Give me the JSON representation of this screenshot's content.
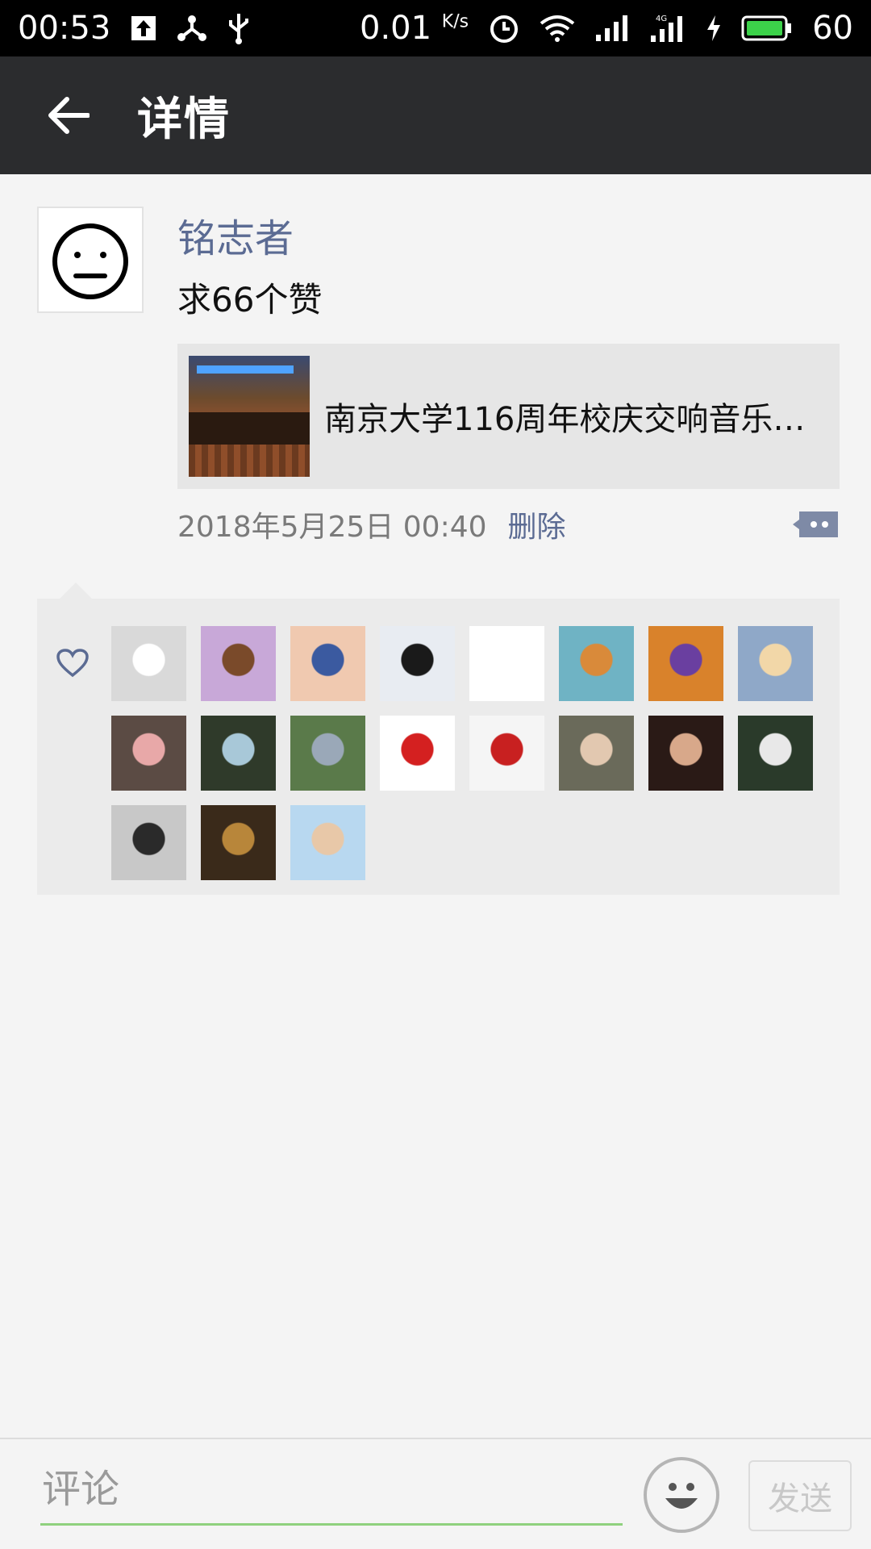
{
  "status_bar": {
    "time": "00:53",
    "net_speed": "0.01",
    "net_unit": "K/s",
    "battery": "60",
    "icons": [
      "upload-icon",
      "usb-tether-icon",
      "usb-icon",
      "alarm-icon",
      "wifi-icon",
      "signal-icon",
      "signal-4g-icon",
      "charging-icon",
      "battery-icon"
    ]
  },
  "app_bar": {
    "title": "详情",
    "back_icon": "back-arrow-icon"
  },
  "post": {
    "author": "铭志者",
    "text": "求66个赞",
    "link": {
      "title": "南京大学116周年校庆交响音乐…"
    },
    "timestamp": "2018年5月25日 00:40",
    "delete_label": "删除",
    "comment_icon": "comment-bubble-icon"
  },
  "likes": {
    "icon": "heart-icon",
    "likers": [
      {
        "color": "#d9d9d9",
        "accent": "#ffffff"
      },
      {
        "color": "#c8a8d8",
        "accent": "#7a4a2a"
      },
      {
        "color": "#f0c9b0",
        "accent": "#3b5aa0"
      },
      {
        "color": "#e8ecf2",
        "accent": "#1a1a1a"
      },
      {
        "color": "#ffffff",
        "accent": "#ffffff"
      },
      {
        "color": "#6fb3c4",
        "accent": "#d98a3a"
      },
      {
        "color": "#d9822b",
        "accent": "#6a3fa0"
      },
      {
        "color": "#8fa8c8",
        "accent": "#f2d7a8"
      },
      {
        "color": "#5b4b44",
        "accent": "#e8a8a8"
      },
      {
        "color": "#2f3a2a",
        "accent": "#a8c8d8"
      },
      {
        "color": "#5a7a4a",
        "accent": "#9aa8b8"
      },
      {
        "color": "#ffffff",
        "accent": "#d42020"
      },
      {
        "color": "#f5f5f5",
        "accent": "#c82020"
      },
      {
        "color": "#6a6a5a",
        "accent": "#e2c8b0"
      },
      {
        "color": "#2a1a16",
        "accent": "#d8a88a"
      },
      {
        "color": "#2a3a2a",
        "accent": "#e8e8e8"
      },
      {
        "color": "#c8c8c8",
        "accent": "#2a2a2a"
      },
      {
        "color": "#3a2a1a",
        "accent": "#b8863a"
      },
      {
        "color": "#b8d8f0",
        "accent": "#e8c8a8"
      }
    ]
  },
  "comment_bar": {
    "placeholder": "评论",
    "emoji_icon": "smiley-icon",
    "send_label": "发送"
  },
  "colors": {
    "link_blue": "#5b6b93",
    "input_underline": "#8fd17e",
    "app_bar_bg": "#2b2c2e"
  }
}
